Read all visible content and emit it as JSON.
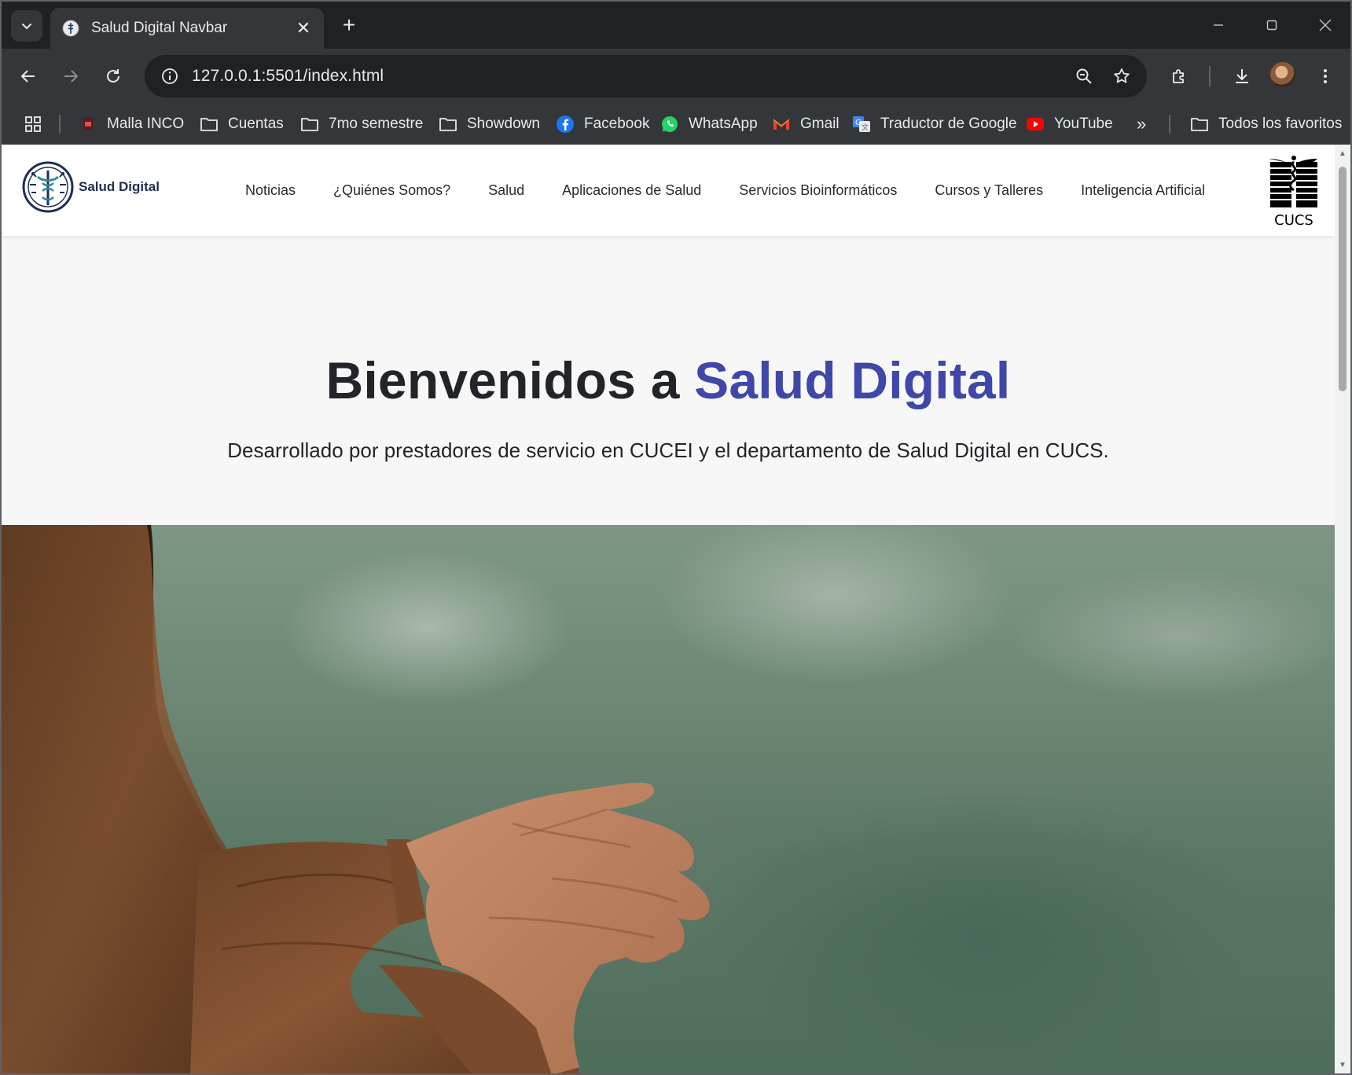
{
  "browser": {
    "tab_title": "Salud Digital Navbar",
    "url": "127.0.0.1:5501/index.html",
    "bookmarks": [
      {
        "label": "Malla INCO",
        "icon": "pdf-icon"
      },
      {
        "label": "Cuentas",
        "icon": "folder-icon"
      },
      {
        "label": "7mo semestre",
        "icon": "folder-icon"
      },
      {
        "label": "Showdown",
        "icon": "folder-icon"
      },
      {
        "label": "Facebook",
        "icon": "facebook-icon"
      },
      {
        "label": "WhatsApp",
        "icon": "whatsapp-icon"
      },
      {
        "label": "Gmail",
        "icon": "gmail-icon"
      },
      {
        "label": "Traductor de Google",
        "icon": "google-translate-icon"
      },
      {
        "label": "YouTube",
        "icon": "youtube-icon"
      }
    ],
    "more_bookmarks": "»",
    "all_bookmarks": "Todos los favoritos"
  },
  "site": {
    "brand": "Salud Digital",
    "nav": [
      "Noticias",
      "¿Quiénes Somos?",
      "Salud",
      "Aplicaciones de Salud",
      "Servicios Bioinformáticos",
      "Cursos y Talleres",
      "Inteligencia Artificial"
    ],
    "partner_logo_text": "CUCS",
    "hero": {
      "title_plain": "Bienvenidos a ",
      "title_accent": "Salud Digital",
      "subtitle": "Desarrollado por prestadores de servicio en CUCEI y el departamento de Salud Digital en CUCS."
    }
  },
  "colors": {
    "accent": "#3f48a8",
    "brand_text": "#1e2f4f",
    "chrome_dark": "#202124",
    "chrome_toolbar": "#35363a"
  }
}
